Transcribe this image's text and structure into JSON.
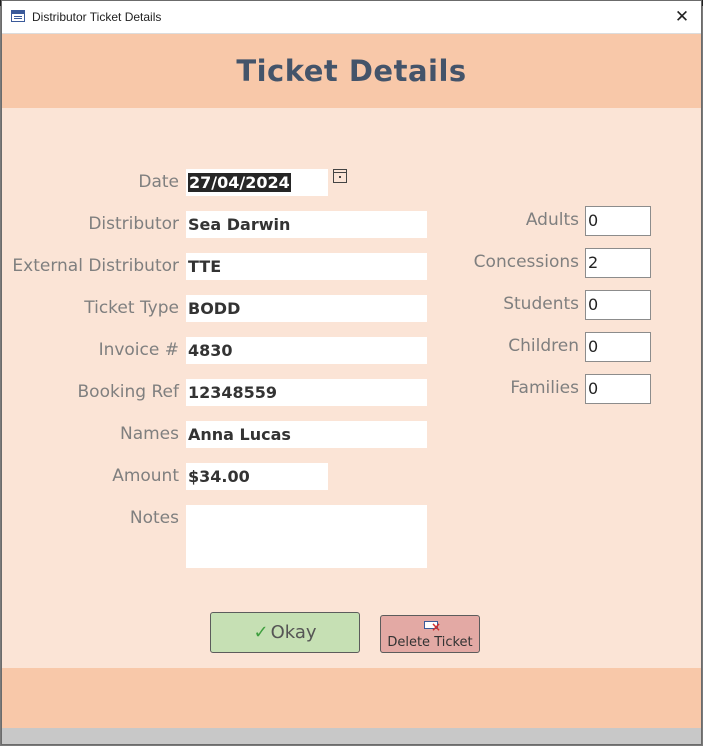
{
  "window": {
    "title": "Distributor Ticket Details",
    "close_symbol": "✕"
  },
  "header": {
    "title": "Ticket Details"
  },
  "form": {
    "date": {
      "label": "Date",
      "value": "27/04/2024"
    },
    "distributor": {
      "label": "Distributor",
      "value": "Sea Darwin"
    },
    "external_distributor": {
      "label": "External Distributor",
      "value": "TTE"
    },
    "ticket_type": {
      "label": "Ticket Type",
      "value": "BODD"
    },
    "invoice": {
      "label": "Invoice #",
      "value": "4830"
    },
    "booking_ref": {
      "label": "Booking Ref",
      "value": "12348559"
    },
    "names": {
      "label": "Names",
      "value": "Anna Lucas"
    },
    "amount": {
      "label": "Amount",
      "value": "$34.00"
    },
    "notes": {
      "label": "Notes",
      "value": ""
    }
  },
  "counts": {
    "adults": {
      "label": "Adults",
      "value": "0"
    },
    "concessions": {
      "label": "Concessions",
      "value": "2"
    },
    "students": {
      "label": "Students",
      "value": "0"
    },
    "children": {
      "label": "Children",
      "value": "0"
    },
    "families": {
      "label": "Families",
      "value": "0"
    }
  },
  "buttons": {
    "okay": "Okay",
    "delete": "Delete Ticket"
  },
  "icons": {
    "app": "form-window-icon",
    "calendar": "calendar-icon",
    "check": "checkmark-icon",
    "delete": "delete-record-icon"
  },
  "colors": {
    "header": "#f8c8a9",
    "body": "#fbe4d6",
    "okay_button": "#c6e0b4",
    "delete_button": "#e3a9a4",
    "title_text": "#44546a"
  }
}
